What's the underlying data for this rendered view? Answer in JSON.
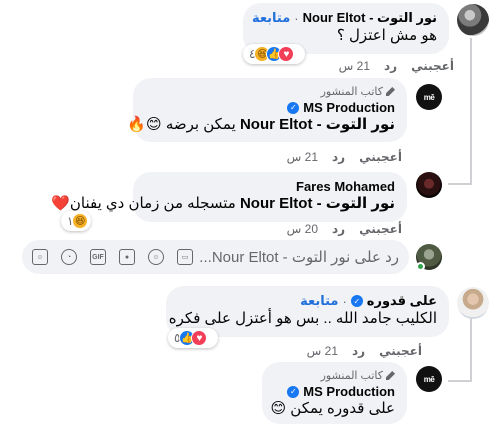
{
  "comments": [
    {
      "name": "نور التوت - Nour Eltot",
      "follow": "متابعة",
      "text": "هو مش اعتزل ؟",
      "reaction_count": "٤",
      "reactions": [
        "like",
        "love",
        "haha"
      ],
      "like": "أعجبني",
      "reply": "رد",
      "time": "21 س"
    },
    {
      "badge": "كاتب المنشور",
      "name": "MS Production",
      "tag": "نور التوت - Nour Eltot",
      "text": "يمكن برضه 😊🔥",
      "like": "أعجبني",
      "reply": "رد",
      "time": "21 س"
    },
    {
      "name": "Fares Mohamed",
      "tag": "نور التوت - Nour Eltot",
      "text": "متسجله من زمان دي يفنان❤️",
      "reaction_count": "١",
      "reactions": [
        "haha"
      ],
      "like": "أعجبني",
      "reply": "رد",
      "time": "20 س"
    },
    {
      "name": "على قدوره",
      "follow": "متابعة",
      "text": "الكليب جامد الله .. بس هو أعتزل على فكره",
      "reaction_count": "٥",
      "reactions": [
        "like",
        "love"
      ],
      "like": "أعجبني",
      "reply": "رد",
      "time": "21 س"
    },
    {
      "badge": "كاتب المنشور",
      "name": "MS Production",
      "text": "على قدوره يمكن 😊"
    }
  ],
  "reply_input": {
    "placeholder": "رد على نور التوت - Nour Eltot..."
  },
  "avatar_text": {
    "ms": "mē"
  },
  "colors": {
    "bubble": "#f0f2f5",
    "link_blue": "#216fdb",
    "meta_gray": "#65676b",
    "verified": "#1877f2",
    "online": "#31a24c"
  }
}
